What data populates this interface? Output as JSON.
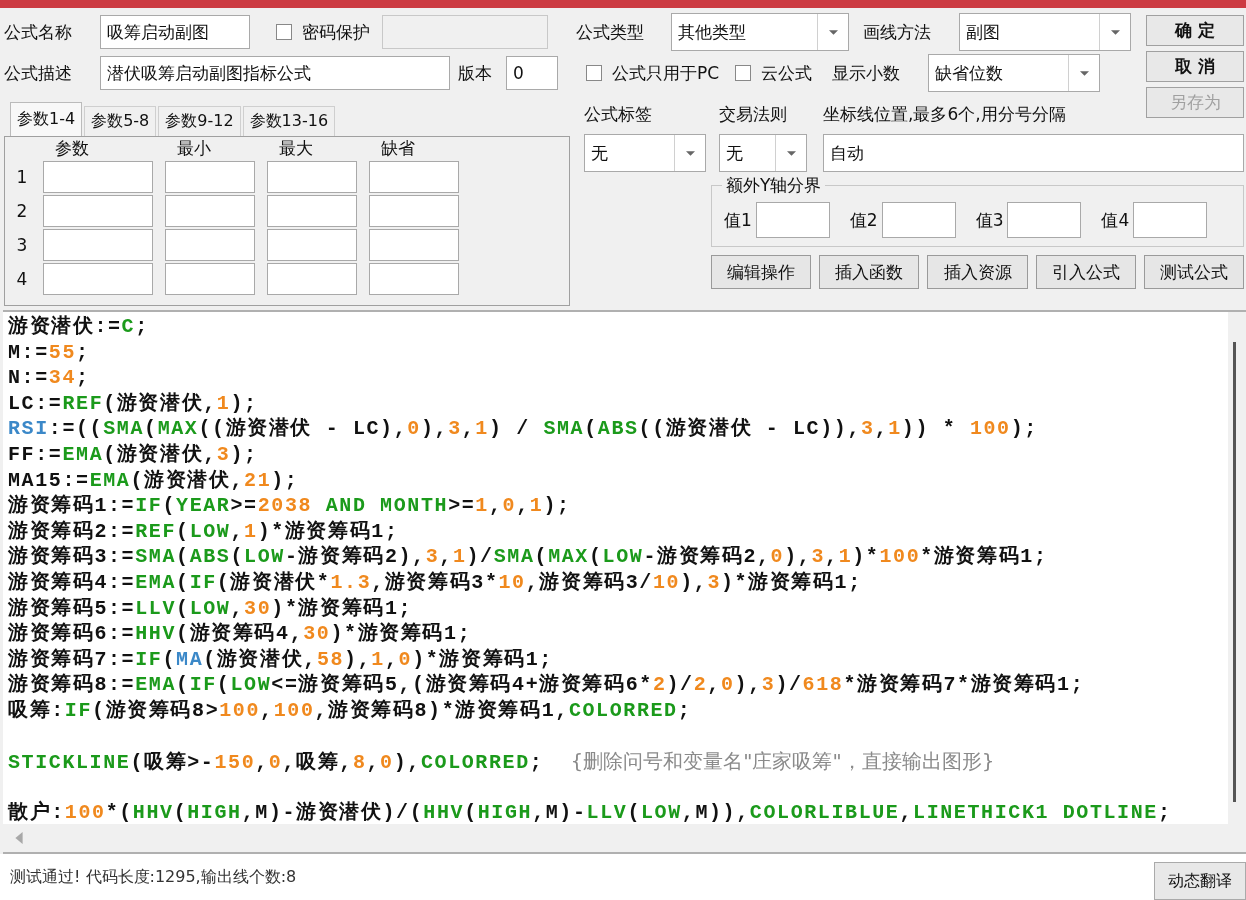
{
  "form": {
    "name_label": "公式名称",
    "name_value": "吸筹启动副图",
    "password": {
      "label": "密码保护",
      "checked": false
    },
    "desc_label": "公式描述",
    "desc_value": "潜伏吸筹启动副图指标公式",
    "version_label": "版本",
    "version_value": "0"
  },
  "param_tabs": [
    {
      "label": "参数1-4",
      "selected": true
    },
    {
      "label": "参数5-8",
      "selected": false
    },
    {
      "label": "参数9-12",
      "selected": false
    },
    {
      "label": "参数13-16",
      "selected": false
    }
  ],
  "param_columns": [
    "参数",
    "最小",
    "最大",
    "缺省"
  ],
  "param_rows": [
    "1",
    "2",
    "3",
    "4"
  ],
  "settings": {
    "type_label": "公式类型",
    "type_value": "其他类型",
    "draw_label": "画线方法",
    "draw_value": "副图",
    "pc_only": {
      "label": "公式只用于PC",
      "checked": false
    },
    "cloud": {
      "label": "云公式",
      "checked": false
    },
    "decimals_label": "显示小数",
    "decimals_value": "缺省位数",
    "tag_label": "公式标签",
    "tag_value": "无",
    "rule_label": "交易法则",
    "rule_value": "无",
    "axis_label": "坐标线位置,最多6个,用分号分隔",
    "axis_value": "自动"
  },
  "dialog_buttons": [
    {
      "label": "确 定",
      "disabled": false
    },
    {
      "label": "取 消",
      "disabled": false
    },
    {
      "label": "另存为",
      "disabled": true
    }
  ],
  "y_axis_group": {
    "title": "额外Y轴分界",
    "fields": [
      "值1",
      "值2",
      "值3",
      "值4"
    ]
  },
  "tool_buttons": [
    "编辑操作",
    "插入函数",
    "插入资源",
    "引入公式",
    "测试公式"
  ],
  "code_lines": [
    {
      "tokens": [
        {
          "kind": "plain",
          "text": "游资潜伏:="
        },
        {
          "kind": "func",
          "text": "C"
        },
        {
          "kind": "plain",
          "text": ";"
        }
      ]
    },
    {
      "tokens": [
        {
          "kind": "plain",
          "text": "M:="
        },
        {
          "kind": "num",
          "text": "55"
        },
        {
          "kind": "plain",
          "text": ";"
        }
      ]
    },
    {
      "tokens": [
        {
          "kind": "plain",
          "text": "N:="
        },
        {
          "kind": "num",
          "text": "34"
        },
        {
          "kind": "plain",
          "text": ";"
        }
      ]
    },
    {
      "tokens": [
        {
          "kind": "plain",
          "text": "LC:="
        },
        {
          "kind": "func",
          "text": "REF"
        },
        {
          "kind": "plain",
          "text": "(游资潜伏,"
        },
        {
          "kind": "num",
          "text": "1"
        },
        {
          "kind": "plain",
          "text": ");"
        }
      ]
    },
    {
      "tokens": [
        {
          "kind": "var",
          "text": "RSI"
        },
        {
          "kind": "plain",
          "text": ":=(("
        },
        {
          "kind": "func",
          "text": "SMA"
        },
        {
          "kind": "plain",
          "text": "("
        },
        {
          "kind": "func",
          "text": "MAX"
        },
        {
          "kind": "plain",
          "text": "((游资潜伏 - LC),"
        },
        {
          "kind": "num",
          "text": "0"
        },
        {
          "kind": "plain",
          "text": "),"
        },
        {
          "kind": "num",
          "text": "3"
        },
        {
          "kind": "plain",
          "text": ","
        },
        {
          "kind": "num",
          "text": "1"
        },
        {
          "kind": "plain",
          "text": ") / "
        },
        {
          "kind": "func",
          "text": "SMA"
        },
        {
          "kind": "plain",
          "text": "("
        },
        {
          "kind": "func",
          "text": "ABS"
        },
        {
          "kind": "plain",
          "text": "((游资潜伏 - LC)),"
        },
        {
          "kind": "num",
          "text": "3"
        },
        {
          "kind": "plain",
          "text": ","
        },
        {
          "kind": "num",
          "text": "1"
        },
        {
          "kind": "plain",
          "text": ")) * "
        },
        {
          "kind": "num",
          "text": "100"
        },
        {
          "kind": "plain",
          "text": ");"
        }
      ]
    },
    {
      "tokens": [
        {
          "kind": "plain",
          "text": "FF:="
        },
        {
          "kind": "func",
          "text": "EMA"
        },
        {
          "kind": "plain",
          "text": "(游资潜伏,"
        },
        {
          "kind": "num",
          "text": "3"
        },
        {
          "kind": "plain",
          "text": ");"
        }
      ]
    },
    {
      "tokens": [
        {
          "kind": "plain",
          "text": "MA15:="
        },
        {
          "kind": "func",
          "text": "EMA"
        },
        {
          "kind": "plain",
          "text": "(游资潜伏,"
        },
        {
          "kind": "num",
          "text": "21"
        },
        {
          "kind": "plain",
          "text": ");"
        }
      ]
    },
    {
      "tokens": [
        {
          "kind": "plain",
          "text": "游资筹码1:="
        },
        {
          "kind": "func",
          "text": "IF"
        },
        {
          "kind": "plain",
          "text": "("
        },
        {
          "kind": "func",
          "text": "YEAR"
        },
        {
          "kind": "plain",
          "text": ">="
        },
        {
          "kind": "num",
          "text": "2038"
        },
        {
          "kind": "func",
          "text": " AND MONTH"
        },
        {
          "kind": "plain",
          "text": ">="
        },
        {
          "kind": "num",
          "text": "1"
        },
        {
          "kind": "plain",
          "text": ","
        },
        {
          "kind": "num",
          "text": "0"
        },
        {
          "kind": "plain",
          "text": ","
        },
        {
          "kind": "num",
          "text": "1"
        },
        {
          "kind": "plain",
          "text": ");"
        }
      ]
    },
    {
      "tokens": [
        {
          "kind": "plain",
          "text": "游资筹码2:="
        },
        {
          "kind": "func",
          "text": "REF"
        },
        {
          "kind": "plain",
          "text": "("
        },
        {
          "kind": "func",
          "text": "LOW"
        },
        {
          "kind": "plain",
          "text": ","
        },
        {
          "kind": "num",
          "text": "1"
        },
        {
          "kind": "plain",
          "text": ")*游资筹码1;"
        }
      ]
    },
    {
      "tokens": [
        {
          "kind": "plain",
          "text": "游资筹码3:="
        },
        {
          "kind": "func",
          "text": "SMA"
        },
        {
          "kind": "plain",
          "text": "("
        },
        {
          "kind": "func",
          "text": "ABS"
        },
        {
          "kind": "plain",
          "text": "("
        },
        {
          "kind": "func",
          "text": "LOW"
        },
        {
          "kind": "plain",
          "text": "-游资筹码2),"
        },
        {
          "kind": "num",
          "text": "3"
        },
        {
          "kind": "plain",
          "text": ","
        },
        {
          "kind": "num",
          "text": "1"
        },
        {
          "kind": "plain",
          "text": ")/"
        },
        {
          "kind": "func",
          "text": "SMA"
        },
        {
          "kind": "plain",
          "text": "("
        },
        {
          "kind": "func",
          "text": "MAX"
        },
        {
          "kind": "plain",
          "text": "("
        },
        {
          "kind": "func",
          "text": "LOW"
        },
        {
          "kind": "plain",
          "text": "-游资筹码2,"
        },
        {
          "kind": "num",
          "text": "0"
        },
        {
          "kind": "plain",
          "text": "),"
        },
        {
          "kind": "num",
          "text": "3"
        },
        {
          "kind": "plain",
          "text": ","
        },
        {
          "kind": "num",
          "text": "1"
        },
        {
          "kind": "plain",
          "text": ")*"
        },
        {
          "kind": "num",
          "text": "100"
        },
        {
          "kind": "plain",
          "text": "*游资筹码1;"
        }
      ]
    },
    {
      "tokens": [
        {
          "kind": "plain",
          "text": "游资筹码4:="
        },
        {
          "kind": "func",
          "text": "EMA"
        },
        {
          "kind": "plain",
          "text": "("
        },
        {
          "kind": "func",
          "text": "IF"
        },
        {
          "kind": "plain",
          "text": "(游资潜伏*"
        },
        {
          "kind": "num",
          "text": "1.3"
        },
        {
          "kind": "plain",
          "text": ",游资筹码3*"
        },
        {
          "kind": "num",
          "text": "10"
        },
        {
          "kind": "plain",
          "text": ",游资筹码3/"
        },
        {
          "kind": "num",
          "text": "10"
        },
        {
          "kind": "plain",
          "text": "),"
        },
        {
          "kind": "num",
          "text": "3"
        },
        {
          "kind": "plain",
          "text": ")*游资筹码1;"
        }
      ]
    },
    {
      "tokens": [
        {
          "kind": "plain",
          "text": "游资筹码5:="
        },
        {
          "kind": "func",
          "text": "LLV"
        },
        {
          "kind": "plain",
          "text": "("
        },
        {
          "kind": "func",
          "text": "LOW"
        },
        {
          "kind": "plain",
          "text": ","
        },
        {
          "kind": "num",
          "text": "30"
        },
        {
          "kind": "plain",
          "text": ")*游资筹码1;"
        }
      ]
    },
    {
      "tokens": [
        {
          "kind": "plain",
          "text": "游资筹码6:="
        },
        {
          "kind": "func",
          "text": "HHV"
        },
        {
          "kind": "plain",
          "text": "(游资筹码4,"
        },
        {
          "kind": "num",
          "text": "30"
        },
        {
          "kind": "plain",
          "text": ")*游资筹码1;"
        }
      ]
    },
    {
      "tokens": [
        {
          "kind": "plain",
          "text": "游资筹码7:="
        },
        {
          "kind": "func",
          "text": "IF"
        },
        {
          "kind": "plain",
          "text": "("
        },
        {
          "kind": "var",
          "text": "MA"
        },
        {
          "kind": "plain",
          "text": "(游资潜伏,"
        },
        {
          "kind": "num",
          "text": "58"
        },
        {
          "kind": "plain",
          "text": "),"
        },
        {
          "kind": "num",
          "text": "1"
        },
        {
          "kind": "plain",
          "text": ","
        },
        {
          "kind": "num",
          "text": "0"
        },
        {
          "kind": "plain",
          "text": ")*游资筹码1;"
        }
      ]
    },
    {
      "tokens": [
        {
          "kind": "plain",
          "text": "游资筹码8:="
        },
        {
          "kind": "func",
          "text": "EMA"
        },
        {
          "kind": "plain",
          "text": "("
        },
        {
          "kind": "func",
          "text": "IF"
        },
        {
          "kind": "plain",
          "text": "("
        },
        {
          "kind": "func",
          "text": "LOW"
        },
        {
          "kind": "plain",
          "text": "<=游资筹码5,(游资筹码4+游资筹码6*"
        },
        {
          "kind": "num",
          "text": "2"
        },
        {
          "kind": "plain",
          "text": ")/"
        },
        {
          "kind": "num",
          "text": "2"
        },
        {
          "kind": "plain",
          "text": ","
        },
        {
          "kind": "num",
          "text": "0"
        },
        {
          "kind": "plain",
          "text": "),"
        },
        {
          "kind": "num",
          "text": "3"
        },
        {
          "kind": "plain",
          "text": ")/"
        },
        {
          "kind": "num",
          "text": "618"
        },
        {
          "kind": "plain",
          "text": "*游资筹码7*游资筹码1;"
        }
      ]
    },
    {
      "tokens": [
        {
          "kind": "plain",
          "text": "吸筹:"
        },
        {
          "kind": "func",
          "text": "IF"
        },
        {
          "kind": "plain",
          "text": "(游资筹码8>"
        },
        {
          "kind": "num",
          "text": "100"
        },
        {
          "kind": "plain",
          "text": ","
        },
        {
          "kind": "num",
          "text": "100"
        },
        {
          "kind": "plain",
          "text": ",游资筹码8)*游资筹码1,"
        },
        {
          "kind": "func",
          "text": "COLORRED"
        },
        {
          "kind": "plain",
          "text": ";"
        }
      ]
    },
    {
      "gap_before": true,
      "tokens": [
        {
          "kind": "func",
          "text": "STICKLINE"
        },
        {
          "kind": "plain",
          "text": "(吸筹>-"
        },
        {
          "kind": "num",
          "text": "150"
        },
        {
          "kind": "plain",
          "text": ","
        },
        {
          "kind": "num",
          "text": "0"
        },
        {
          "kind": "plain",
          "text": ",吸筹,"
        },
        {
          "kind": "num",
          "text": "8"
        },
        {
          "kind": "plain",
          "text": ","
        },
        {
          "kind": "num",
          "text": "0"
        },
        {
          "kind": "plain",
          "text": "),"
        },
        {
          "kind": "func",
          "text": "COLORRED"
        },
        {
          "kind": "plain",
          "text": ";  "
        },
        {
          "kind": "comment",
          "text": "{删除问号和变量名\"庄家吸筹\"，直接输出图形}"
        }
      ]
    },
    {
      "gap_before": true,
      "tokens": [
        {
          "kind": "plain",
          "text": "散户:"
        },
        {
          "kind": "num",
          "text": "100"
        },
        {
          "kind": "plain",
          "text": "*("
        },
        {
          "kind": "func",
          "text": "HHV"
        },
        {
          "kind": "plain",
          "text": "("
        },
        {
          "kind": "func",
          "text": "HIGH"
        },
        {
          "kind": "plain",
          "text": ",M)-游资潜伏)/("
        },
        {
          "kind": "func",
          "text": "HHV"
        },
        {
          "kind": "plain",
          "text": "("
        },
        {
          "kind": "func",
          "text": "HIGH"
        },
        {
          "kind": "plain",
          "text": ",M)-"
        },
        {
          "kind": "func",
          "text": "LLV"
        },
        {
          "kind": "plain",
          "text": "("
        },
        {
          "kind": "func",
          "text": "LOW"
        },
        {
          "kind": "plain",
          "text": ",M)),"
        },
        {
          "kind": "func",
          "text": "COLORLIBLUE"
        },
        {
          "kind": "plain",
          "text": ","
        },
        {
          "kind": "func",
          "text": "LINETHICK1 DOTLINE"
        },
        {
          "kind": "plain",
          "text": ";"
        }
      ]
    }
  ],
  "status": "测试通过! 代码长度:1295,输出线个数:8",
  "translate_button": "动态翻译"
}
